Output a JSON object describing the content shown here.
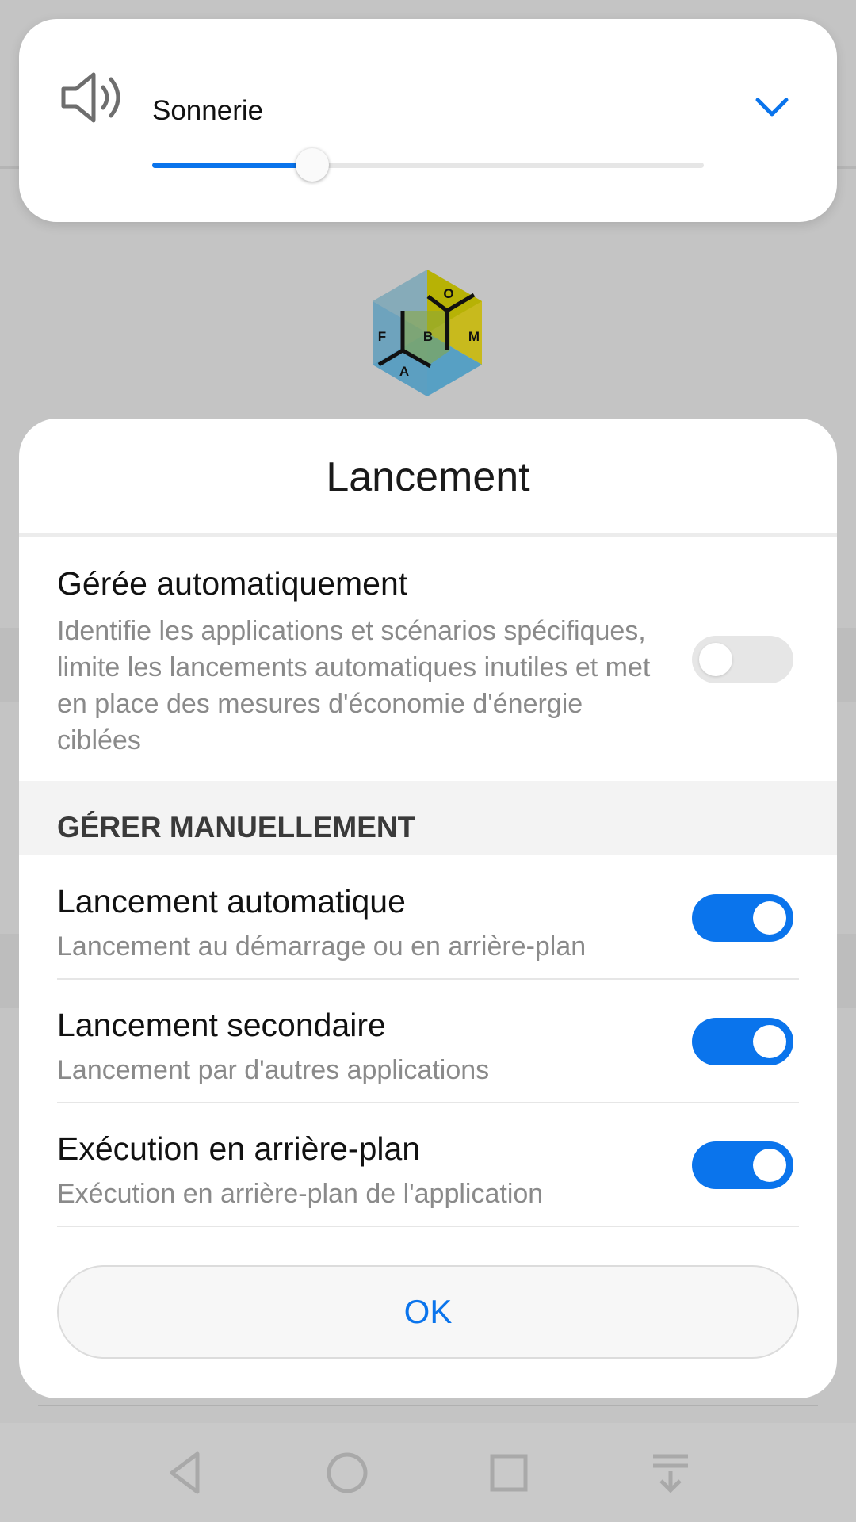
{
  "volume": {
    "label": "Sonnerie",
    "level_percent": 29,
    "icon": "speaker-icon",
    "expand_icon": "chevron-down-icon"
  },
  "background": {
    "logo_letters": {
      "top": "O",
      "left": "F",
      "center": "B",
      "right": "M",
      "bottom": "A"
    },
    "navbar_icons": [
      "back-icon",
      "home-icon",
      "recents-icon",
      "notification-pull-icon"
    ]
  },
  "dialog": {
    "title": "Lancement",
    "auto": {
      "title": "Gérée automatiquement",
      "description": "Identifie les applications et scénarios spécifiques, limite les lancements automatiques inutiles et met en place des mesures d'économie d'énergie ciblées",
      "enabled": false
    },
    "section_header": "GÉRER MANUELLEMENT",
    "items": [
      {
        "title": "Lancement automatique",
        "description": "Lancement au démarrage ou en arrière-plan",
        "enabled": true
      },
      {
        "title": "Lancement secondaire",
        "description": "Lancement par d'autres applications",
        "enabled": true
      },
      {
        "title": "Exécution en arrière-plan",
        "description": "Exécution en arrière-plan de l'application",
        "enabled": true
      }
    ],
    "ok_label": "OK"
  },
  "colors": {
    "accent": "#0a74ec",
    "scrim": "#c4c4c4",
    "logo_yellow": "#c9b800",
    "logo_blue": "#4b9cc4",
    "logo_green": "#8aa83c"
  }
}
